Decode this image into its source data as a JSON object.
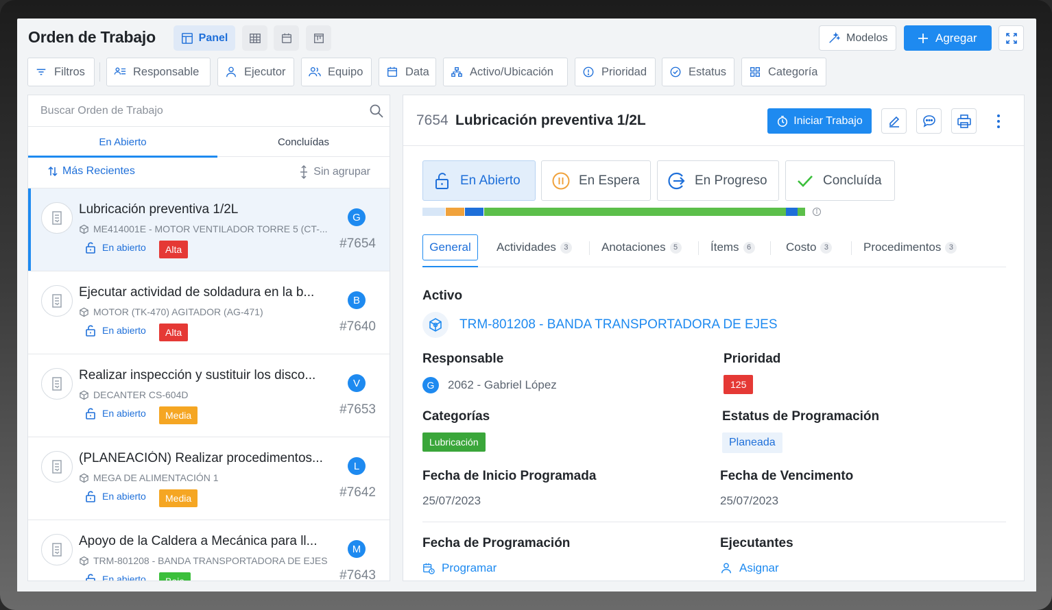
{
  "header": {
    "title": "Orden de Trabajo",
    "views": {
      "panel_label": "Panel",
      "others": [
        "table-icon",
        "calendar-icon",
        "board-icon"
      ]
    },
    "models_label": "Modelos",
    "add_label": "Agregar"
  },
  "filters": [
    "Filtros",
    "Responsable",
    "Ejecutor",
    "Equipo",
    "Data",
    "Activo/Ubicación",
    "Prioridad",
    "Estatus",
    "Categoría"
  ],
  "list": {
    "search_placeholder": "Buscar Orden de Trabajo",
    "tabs": [
      "En Abierto",
      "Concluídas"
    ],
    "sort_label": "Más Recientes",
    "group_label": "Sin agrupar",
    "items": [
      {
        "title": "Lubricación preventiva  1/2L",
        "asset": "ME414001E - MOTOR VENTILADOR TORRE 5 (CT-...",
        "status": "En abierto",
        "priority": "Alta",
        "priority_color": "#e53935",
        "avatar": "G",
        "number": "#7654"
      },
      {
        "title": "Ejecutar actividad de soldadura en la b...",
        "asset": "MOTOR (TK-470) AGITADOR (AG-471)",
        "status": "En abierto",
        "priority": "Alta",
        "priority_color": "#e53935",
        "avatar": "B",
        "number": "#7640"
      },
      {
        "title": "Realizar inspección y sustituir los disco...",
        "asset": "DECANTER CS-604D",
        "status": "En abierto",
        "priority": "Media",
        "priority_color": "#f5a623",
        "avatar": "V",
        "number": "#7653"
      },
      {
        "title": "(PLANEACIÓN) Realizar procedimentos...",
        "asset": "MEGA DE ALIMENTACIÓN 1",
        "status": "En abierto",
        "priority": "Media",
        "priority_color": "#f5a623",
        "avatar": "L",
        "number": "#7642"
      },
      {
        "title": "Apoyo de la Caldera a Mecánica para ll...",
        "asset": "TRM-801208 - BANDA TRANSPORTADORA DE EJES",
        "status": "En abierto",
        "priority": "Baja",
        "priority_color": "#3bbf3b",
        "avatar": "M",
        "number": "#7643"
      }
    ]
  },
  "detail": {
    "id": "7654",
    "title": "Lubricación preventiva  1/2L",
    "start_label": "Iniciar Trabajo",
    "statuses": [
      "En Abierto",
      "En Espera",
      "En Progreso",
      "Concluída"
    ],
    "progress_colors": [
      "#d7e6f7",
      "#f0a23c",
      "#1e6fd9",
      "#5cbf4a",
      "#1e6fd9",
      "#5cbf4a"
    ],
    "tabs": [
      {
        "label": "General",
        "count": ""
      },
      {
        "label": "Actividades",
        "count": "3"
      },
      {
        "label": "Anotaciones",
        "count": "5"
      },
      {
        "label": "Ítems",
        "count": "6"
      },
      {
        "label": "Costo",
        "count": "3"
      },
      {
        "label": "Procedimentos",
        "count": "3"
      }
    ],
    "asset_label": "Activo",
    "asset_value": "TRM-801208 - BANDA TRANSPORTADORA DE EJES",
    "responsible_label": "Responsable",
    "responsible_avatar": "G",
    "responsible_value": "2062 - Gabriel López",
    "priority_label": "Prioridad",
    "priority_value": "125",
    "categories_label": "Categorías",
    "category_value": "Lubricación",
    "schedule_status_label": "Estatus de Programación",
    "schedule_status_value": "Planeada",
    "start_date_label": "Fecha de Inicio Programada",
    "start_date_value": "25/07/2023",
    "due_date_label": "Fecha de Vencimento",
    "due_date_value": "25/07/2023",
    "program_date_label": "Fecha de Programación",
    "program_action": "Programar",
    "executors_label": "Ejecutantes",
    "executors_action": "Asignar"
  }
}
